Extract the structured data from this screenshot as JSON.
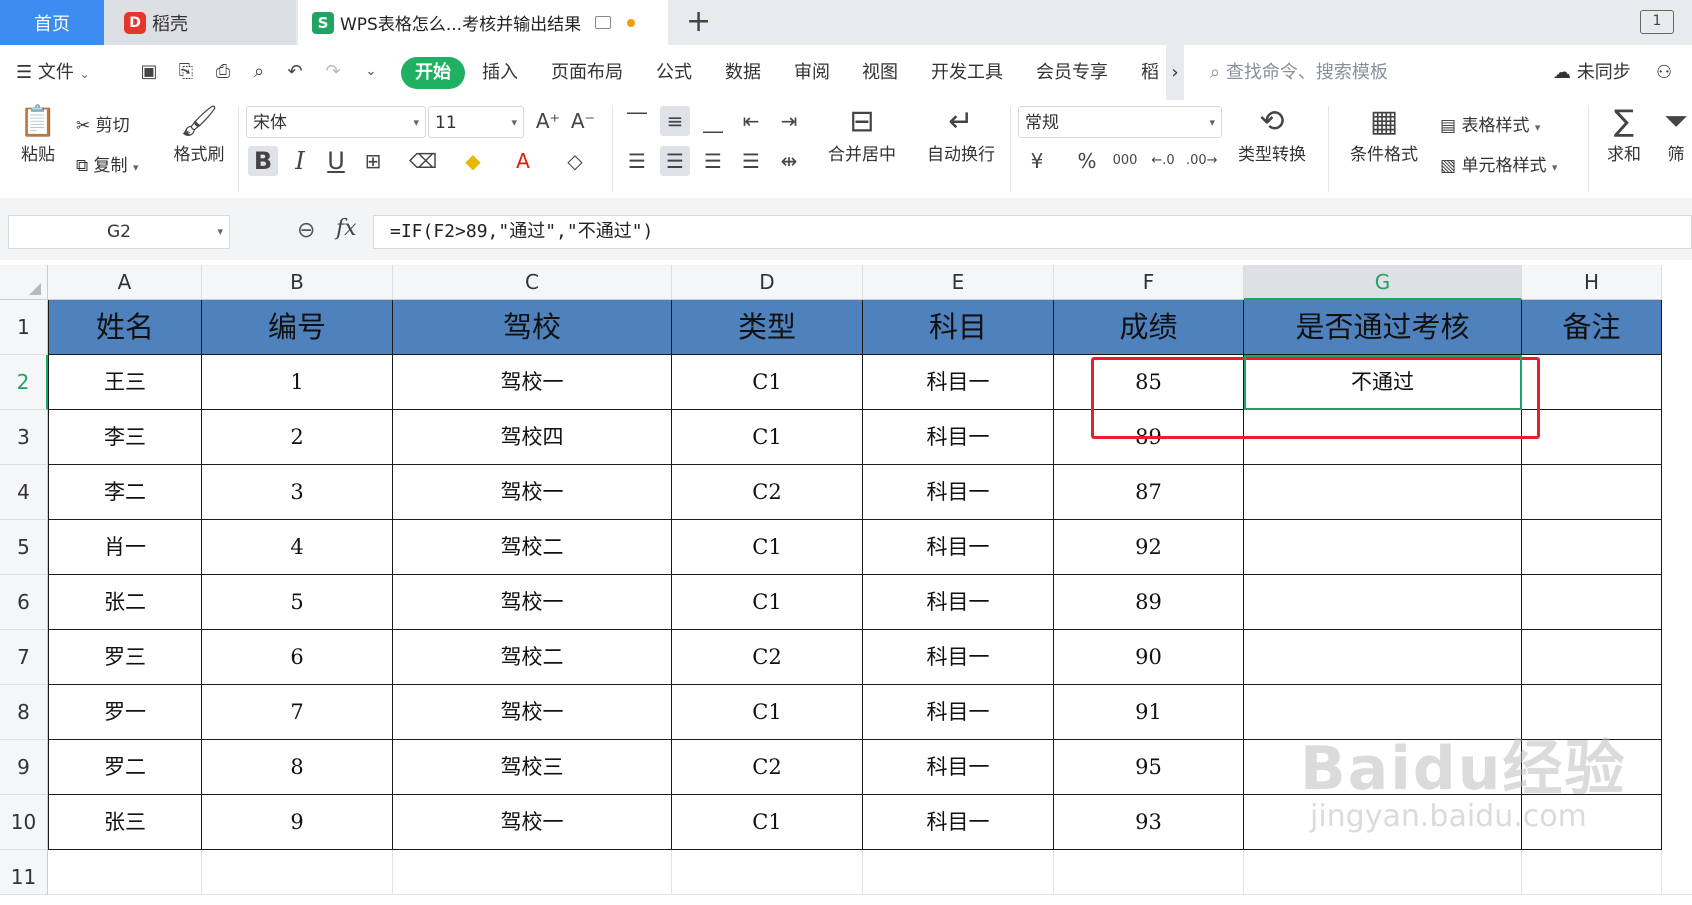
{
  "tabs": {
    "home": "首页",
    "daoke": "稻壳",
    "daoke_logo": "D",
    "doc": "WPS表格怎么...考核并输出结果",
    "doc_logo": "S",
    "new_tab": "+",
    "window_btn": "1"
  },
  "menu": {
    "file": "文件",
    "start": "开始",
    "items": [
      "插入",
      "页面布局",
      "公式",
      "数据",
      "审阅",
      "视图",
      "开发工具",
      "会员专享",
      "稻"
    ],
    "more": "›",
    "search_placeholder": "查找命令、搜索模板",
    "sync": "未同步"
  },
  "ribbon": {
    "paste": "粘贴",
    "cut": "剪切",
    "copy": "复制",
    "format_painter": "格式刷",
    "font_name": "宋体",
    "font_size": "11",
    "bold": "B",
    "italic": "I",
    "underline": "U",
    "merge_center": "合并居中",
    "wrap_text": "自动换行",
    "number_format": "常规",
    "currency": "¥",
    "percent": "%",
    "thousands": "000",
    "type_convert": "类型转换",
    "cond_format": "条件格式",
    "table_style": "表格样式",
    "cell_style": "单元格样式",
    "sum": "求和",
    "filter": "筛"
  },
  "formula_bar": {
    "name_box": "G2",
    "fx": "fx",
    "formula": "=IF(F2>89,\"通过\",\"不通过\")"
  },
  "sheet": {
    "columns": [
      "A",
      "B",
      "C",
      "D",
      "E",
      "F",
      "G",
      "H"
    ],
    "row_numbers": [
      "1",
      "2",
      "3",
      "4",
      "5",
      "6",
      "7",
      "8",
      "9",
      "10",
      "11"
    ],
    "headers": [
      "姓名",
      "编号",
      "驾校",
      "类型",
      "科目",
      "成绩",
      "是否通过考核",
      "备注"
    ],
    "rows": [
      [
        "王三",
        "1",
        "驾校一",
        "C1",
        "科目一",
        "85",
        "不通过",
        ""
      ],
      [
        "李三",
        "2",
        "驾校四",
        "C1",
        "科目一",
        "89",
        "",
        ""
      ],
      [
        "李二",
        "3",
        "驾校一",
        "C2",
        "科目一",
        "87",
        "",
        ""
      ],
      [
        "肖一",
        "4",
        "驾校二",
        "C1",
        "科目一",
        "92",
        "",
        ""
      ],
      [
        "张二",
        "5",
        "驾校一",
        "C1",
        "科目一",
        "89",
        "",
        ""
      ],
      [
        "罗三",
        "6",
        "驾校二",
        "C2",
        "科目一",
        "90",
        "",
        ""
      ],
      [
        "罗一",
        "7",
        "驾校一",
        "C1",
        "科目一",
        "91",
        "",
        ""
      ],
      [
        "罗二",
        "8",
        "驾校三",
        "C2",
        "科目一",
        "95",
        "",
        ""
      ],
      [
        "张三",
        "9",
        "驾校一",
        "C1",
        "科目一",
        "93",
        "",
        ""
      ]
    ]
  },
  "watermark": {
    "brand": "Baidu经验",
    "url": "jingyan.baidu.com"
  },
  "colors": {
    "header_fill": "#4f81bd",
    "accent_green": "#1fa463",
    "annotation_red": "#e8202a",
    "home_tab": "#3d8cf2"
  }
}
